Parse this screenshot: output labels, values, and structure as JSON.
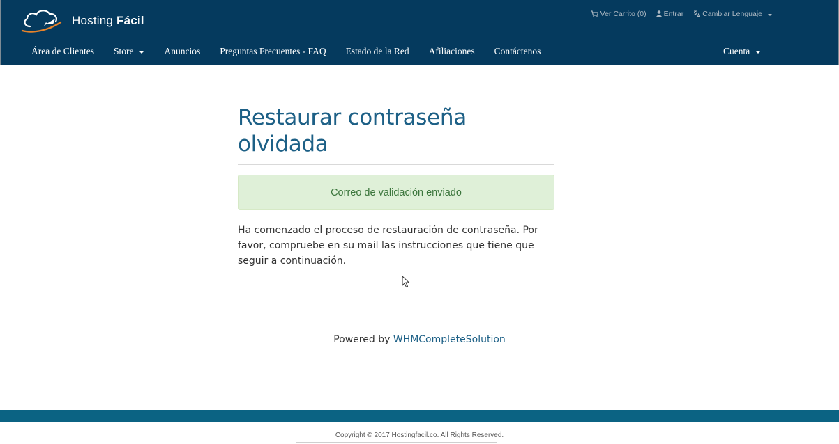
{
  "brand": {
    "name_regular": "Hosting",
    "name_bold": "Fácil",
    "logo_icon": "cloud-rocket-logo"
  },
  "top_links": {
    "cart": {
      "label": "Ver Carrito (0)",
      "icon": "cart-icon"
    },
    "login": {
      "label": "Entrar",
      "icon": "user-icon"
    },
    "language": {
      "label": "Cambiar Lenguaje",
      "icon": "language-icon"
    }
  },
  "nav": {
    "items": [
      {
        "label": "Área de Clientes"
      },
      {
        "label": "Store"
      },
      {
        "label": "Anuncios"
      },
      {
        "label": "Preguntas Frecuentes - FAQ"
      },
      {
        "label": "Estado de la Red"
      },
      {
        "label": "Afiliaciones"
      },
      {
        "label": "Contáctenos"
      }
    ],
    "account": "Cuenta"
  },
  "main": {
    "title_line1": "Restaurar contraseña",
    "title_line2": "olvidada",
    "alert": "Correo de validación enviado",
    "message": "Ha comenzado el proceso de restauración de contraseña. Por favor, compruebe en su mail las instrucciones que tiene que seguir a continuación."
  },
  "powered": {
    "prefix": "Powered by",
    "link": "WHMCompleteSolution"
  },
  "footer": {
    "copyright": "Copyright © 2017 Hostingfacil.co. All Rights Reserved."
  },
  "colors": {
    "header_bg": "#053a5e",
    "accent": "#1d6086",
    "alert_bg": "#dff0d8",
    "alert_text": "#3c763d",
    "footer_bar": "#0b6383",
    "logo_swoosh": "#e8832a"
  }
}
